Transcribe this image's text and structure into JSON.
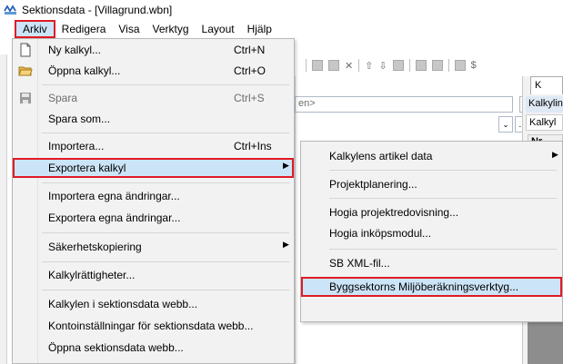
{
  "window": {
    "title": "Sektionsdata - [Villagrund.wbn]",
    "icon": "app-logo-icon"
  },
  "menubar": {
    "items": [
      {
        "label": "Arkiv",
        "active": true
      },
      {
        "label": "Redigera"
      },
      {
        "label": "Visa"
      },
      {
        "label": "Verktyg"
      },
      {
        "label": "Layout"
      },
      {
        "label": "Hjälp"
      }
    ]
  },
  "arkiv_menu": {
    "items": [
      {
        "label": "Ny kalkyl...",
        "shortcut": "Ctrl+N",
        "icon": "new-document-icon"
      },
      {
        "label": "Öppna kalkyl...",
        "shortcut": "Ctrl+O",
        "icon": "open-folder-icon"
      },
      {
        "label": "Spara",
        "shortcut": "Ctrl+S",
        "icon": "save-icon",
        "disabled": true
      },
      {
        "label": "Spara som..."
      },
      {
        "label": "Importera...",
        "shortcut": "Ctrl+Ins"
      },
      {
        "label": "Exportera kalkyl",
        "submenu": true,
        "highlighted": true
      },
      {
        "label": "Importera egna ändringar..."
      },
      {
        "label": "Exportera egna ändringar..."
      },
      {
        "label": "Säkerhetskopiering",
        "submenu": true
      },
      {
        "label": "Kalkylrättigheter..."
      },
      {
        "label": "Kalkylen i sektionsdata webb..."
      },
      {
        "label": "Kontoinställningar för sektionsdata webb..."
      },
      {
        "label": "Öppna sektionsdata webb..."
      }
    ]
  },
  "export_submenu": {
    "items": [
      {
        "label": "Kalkylens artikel data",
        "submenu": true
      },
      {
        "label": "Projektplanering..."
      },
      {
        "label": "Hogia projektredovisning..."
      },
      {
        "label": "Hogia inköpsmodul..."
      },
      {
        "label": "SB XML-fil..."
      },
      {
        "label": "Byggsektorns Miljöberäkningsverktyg...",
        "highlighted": true
      }
    ]
  },
  "background": {
    "field_text": "en>",
    "tab_label": "K",
    "kalkylin": "Kalkylin",
    "kalkyl": "Kalkyl",
    "nr_header": "Nr"
  },
  "colors": {
    "highlight": "#cce4f7",
    "annotation_border": "#e01b24",
    "menu_bg": "#f2f2f2"
  }
}
